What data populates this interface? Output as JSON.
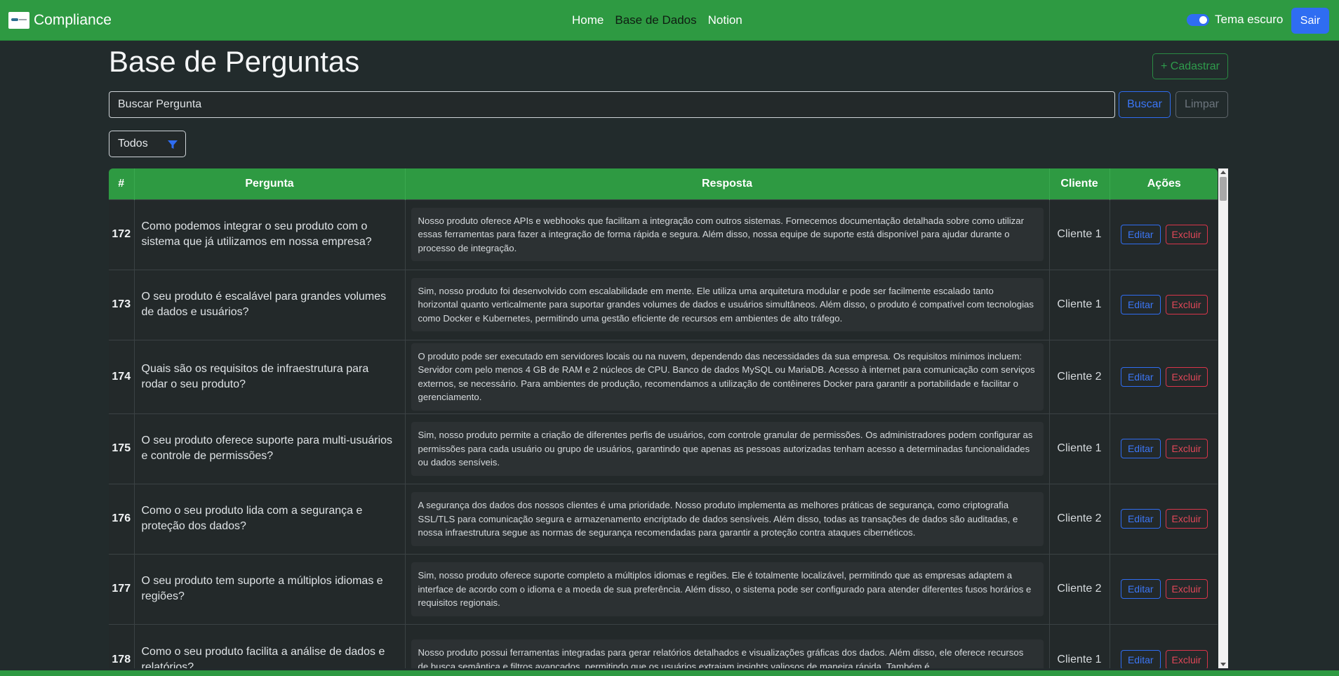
{
  "navbar": {
    "brand": "Compliance",
    "links": [
      "Home",
      "Base de Dados",
      "Notion"
    ],
    "active_link": "Base de Dados",
    "theme_label": "Tema escuro",
    "theme_on": true,
    "logout": "Sair"
  },
  "page": {
    "title": "Base de Perguntas",
    "add_button": "+ Cadastrar"
  },
  "search": {
    "placeholder": "Buscar Pergunta",
    "buscar": "Buscar",
    "limpar": "Limpar"
  },
  "filter": {
    "selected": "Todos",
    "icon": "filter-icon"
  },
  "table": {
    "headers": [
      "#",
      "Pergunta",
      "Resposta",
      "Cliente",
      "Ações"
    ],
    "edit_label": "Editar",
    "delete_label": "Excluir",
    "rows": [
      {
        "id": "172",
        "pergunta": "Como podemos integrar o seu produto com o sistema que já utilizamos em nossa empresa?",
        "resposta": "Nosso produto oferece APIs e webhooks que facilitam a integração com outros sistemas. Fornecemos documentação detalhada sobre como utilizar essas ferramentas para fazer a integração de forma rápida e segura. Além disso, nossa equipe de suporte está disponível para ajudar durante o processo de integração.",
        "cliente": "Cliente 1"
      },
      {
        "id": "173",
        "pergunta": "O seu produto é escalável para grandes volumes de dados e usuários?",
        "resposta": "Sim, nosso produto foi desenvolvido com escalabilidade em mente. Ele utiliza uma arquitetura modular e pode ser facilmente escalado tanto horizontal quanto verticalmente para suportar grandes volumes de dados e usuários simultâneos. Além disso, o produto é compatível com tecnologias como Docker e Kubernetes, permitindo uma gestão eficiente de recursos em ambientes de alto tráfego.",
        "cliente": "Cliente 1"
      },
      {
        "id": "174",
        "pergunta": "Quais são os requisitos de infraestrutura para rodar o seu produto?",
        "resposta": "O produto pode ser executado em servidores locais ou na nuvem, dependendo das necessidades da sua empresa. Os requisitos mínimos incluem: Servidor com pelo menos 4 GB de RAM e 2 núcleos de CPU. Banco de dados MySQL ou MariaDB. Acesso à internet para comunicação com serviços externos, se necessário. Para ambientes de produção, recomendamos a utilização de contêineres Docker para garantir a portabilidade e facilitar o gerenciamento.",
        "cliente": "Cliente 2"
      },
      {
        "id": "175",
        "pergunta": "O seu produto oferece suporte para multi-usuários e controle de permissões?",
        "resposta": "Sim, nosso produto permite a criação de diferentes perfis de usuários, com controle granular de permissões. Os administradores podem configurar as permissões para cada usuário ou grupo de usuários, garantindo que apenas as pessoas autorizadas tenham acesso a determinadas funcionalidades ou dados sensíveis.",
        "cliente": "Cliente 1"
      },
      {
        "id": "176",
        "pergunta": "Como o seu produto lida com a segurança e proteção dos dados?",
        "resposta": "A segurança dos dados dos nossos clientes é uma prioridade. Nosso produto implementa as melhores práticas de segurança, como criptografia SSL/TLS para comunicação segura e armazenamento encriptado de dados sensíveis. Além disso, todas as transações de dados são auditadas, e nossa infraestrutura segue as normas de segurança recomendadas para garantir a proteção contra ataques cibernéticos.",
        "cliente": "Cliente 2"
      },
      {
        "id": "177",
        "pergunta": "O seu produto tem suporte a múltiplos idiomas e regiões?",
        "resposta": "Sim, nosso produto oferece suporte completo a múltiplos idiomas e regiões. Ele é totalmente localizável, permitindo que as empresas adaptem a interface de acordo com o idioma e a moeda de sua preferência. Além disso, o sistema pode ser configurado para atender diferentes fusos horários e requisitos regionais.",
        "cliente": "Cliente 2"
      },
      {
        "id": "178",
        "pergunta": "Como o seu produto facilita a análise de dados e relatórios?",
        "resposta": "Nosso produto possui ferramentas integradas para gerar relatórios detalhados e visualizações gráficas dos dados. Além disso, ele oferece recursos de busca semântica e filtros avançados, permitindo que os usuários extraiam insights valiosos de maneira rápida. Também é",
        "cliente": "Cliente 1"
      }
    ]
  }
}
